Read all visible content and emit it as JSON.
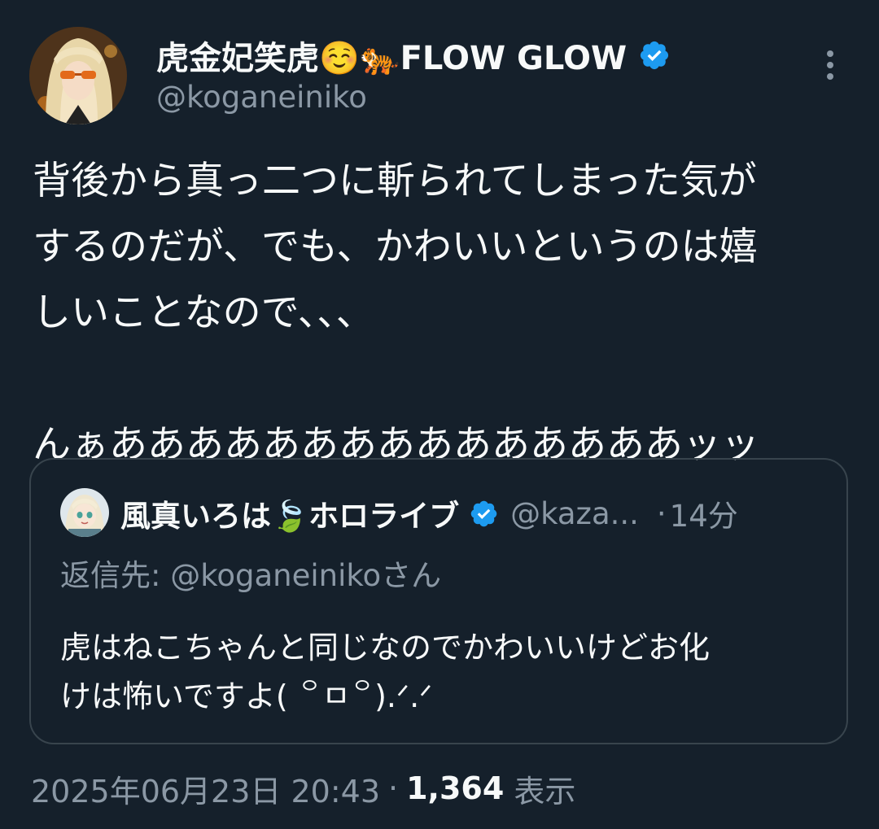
{
  "author": {
    "name": "虎金妃笑虎☺️🐅FLOW GLOW",
    "handle": "@koganeiniko",
    "verified": true,
    "avatar_icon": "profile-avatar-blonde-sunglasses"
  },
  "more_icon": "more-vertical-icon",
  "tweet": {
    "lines": [
      "背後から真っ二つに斬られてしまった気が",
      "するのだが、でも、かわいいというのは嬉",
      "しいことなので、、、",
      "",
      "んぁあああああああああああああああッッ"
    ]
  },
  "quote": {
    "name": "風真いろは🍃ホロライブ",
    "handle": "@kaza...",
    "separator": "·",
    "time": "14分",
    "verified": true,
    "avatar_icon": "profile-avatar-anime-girl",
    "reply_to": "返信先: @koganeinikoさん",
    "text_lines": [
      "虎はねこちゃんと同じなのでかわいいけどお化",
      "けは怖いですよ( ꒪ㅁ꒪).ᐟ.ᐟ"
    ]
  },
  "meta": {
    "timestamp": "2025年06月23日 20:43",
    "separator": "·",
    "views_count": "1,364",
    "views_label": "表示"
  },
  "colors": {
    "background": "#15202b",
    "text_primary": "#f7f9f9",
    "text_secondary": "#8b98a5",
    "border": "#38444d",
    "verified_blue": "#1d9bf0"
  }
}
